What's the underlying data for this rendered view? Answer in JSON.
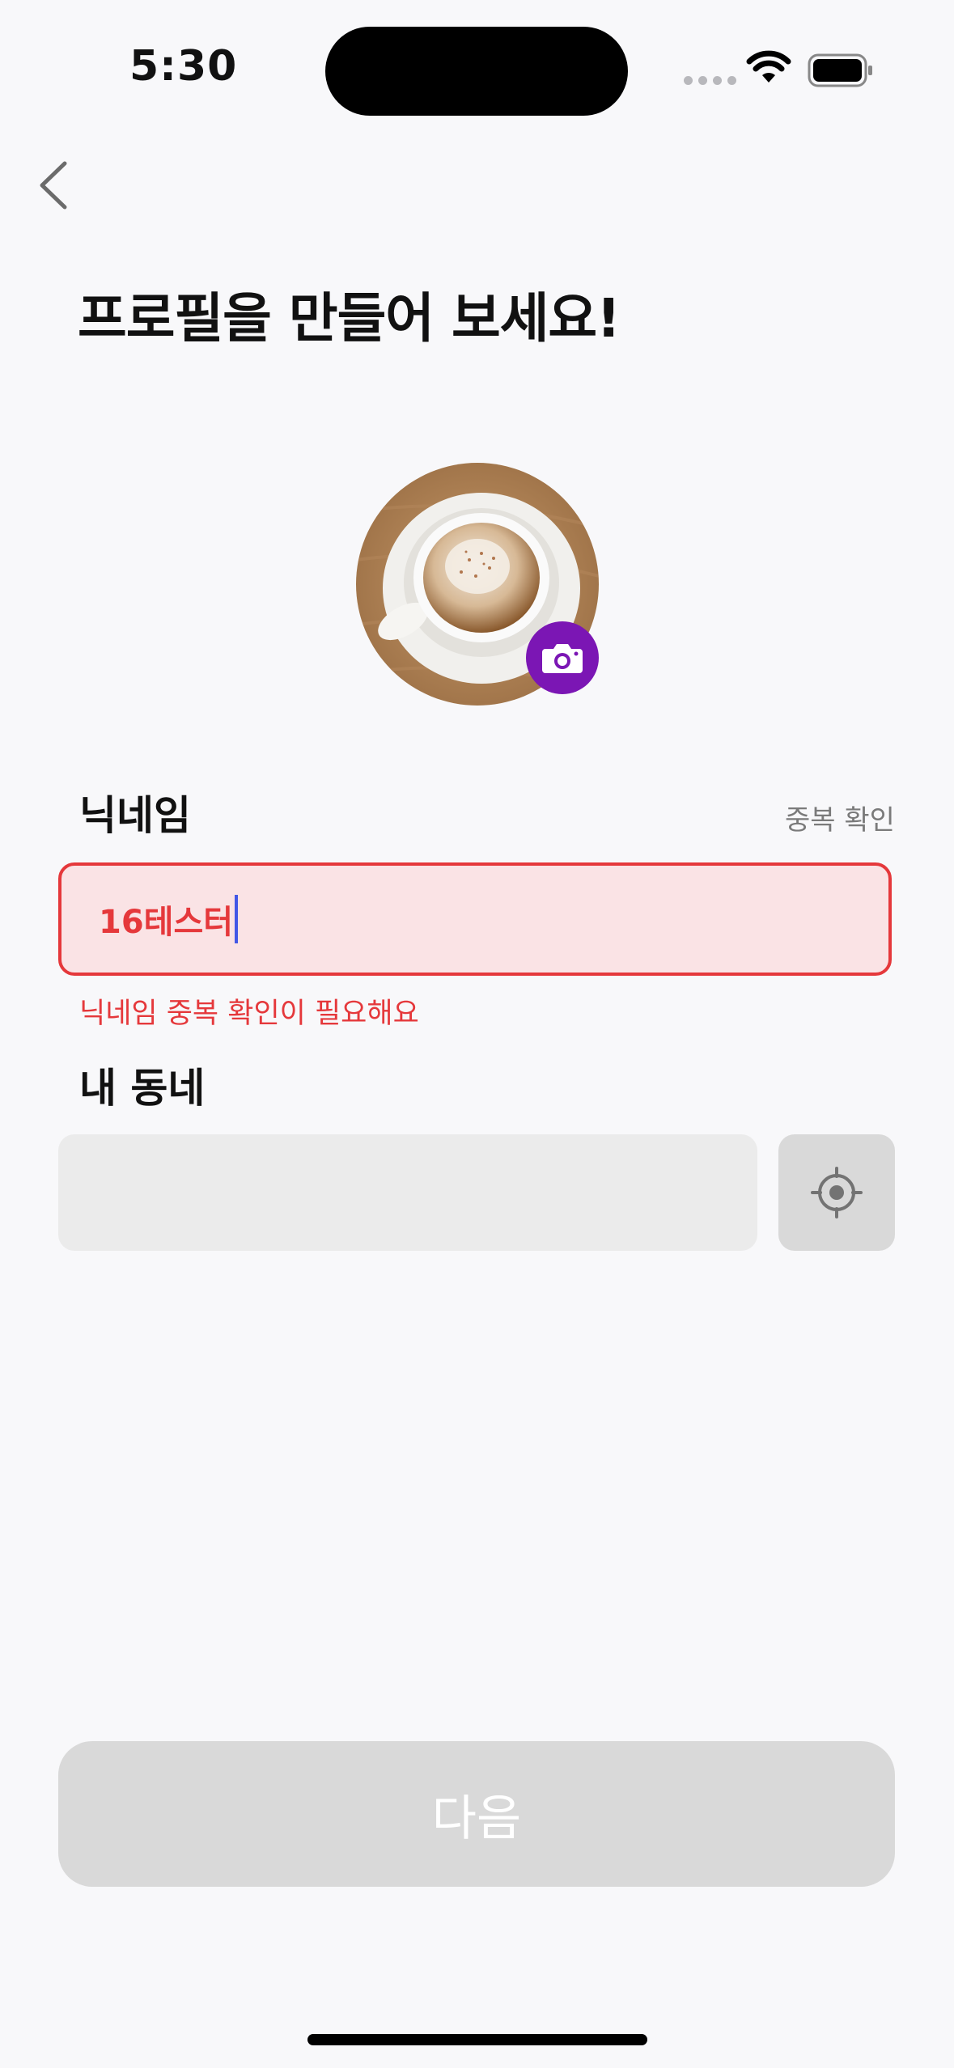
{
  "status_bar": {
    "time": "5:30"
  },
  "header": {
    "back_icon": "chevron-left-icon",
    "title": "프로필을 만들어 보세요!"
  },
  "profile": {
    "avatar_description_icon": "coffee-cup-photo",
    "camera_icon": "camera-icon",
    "camera_color": "#7b16b4"
  },
  "nickname": {
    "label": "닉네임",
    "duplicate_check": "중복 확인",
    "value": "16테스터",
    "error": "닉네임 중복 확인이 필요해요",
    "error_color": "#e5383b"
  },
  "neighborhood": {
    "label": "내 동네",
    "value": "",
    "location_icon": "crosshair-location-icon"
  },
  "footer": {
    "next_button": "다음"
  }
}
